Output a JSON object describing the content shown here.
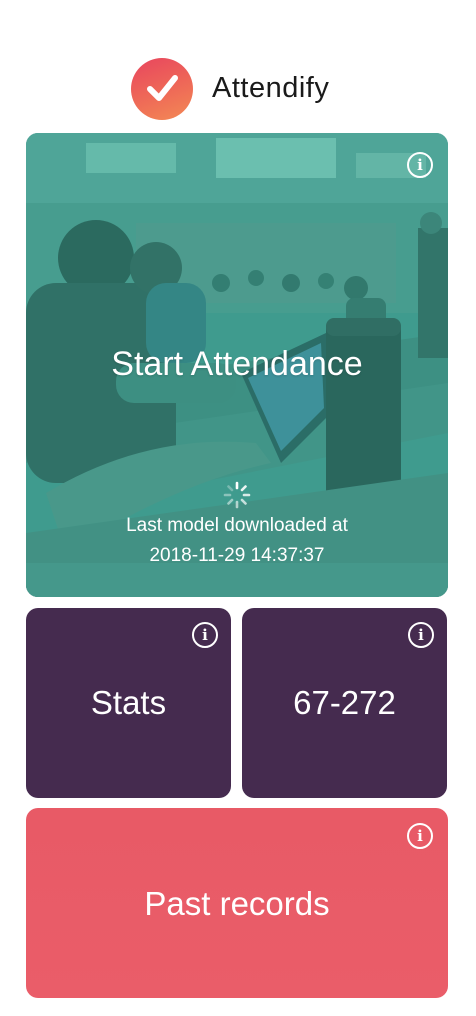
{
  "header": {
    "app_name": "Attendify",
    "logo_icon": "checkmark-icon",
    "logo_color": "#ea5a5e"
  },
  "start_card": {
    "label": "Start Attendance",
    "status_line_1": "Last model downloaded at",
    "status_line_2": "2018-11-29 14:37:37",
    "info_icon": "info-icon",
    "background_photo": "classroom-students-with-laptops",
    "overlay_color": "#3fa99a"
  },
  "stats_card": {
    "label": "Stats",
    "info_icon": "info-icon",
    "color": "#452b4f"
  },
  "class_card": {
    "label": "67-272",
    "info_icon": "info-icon",
    "color": "#452b4f"
  },
  "past_card": {
    "label": "Past records",
    "info_icon": "info-icon",
    "color": "#e85a66"
  },
  "info_symbol": "i"
}
